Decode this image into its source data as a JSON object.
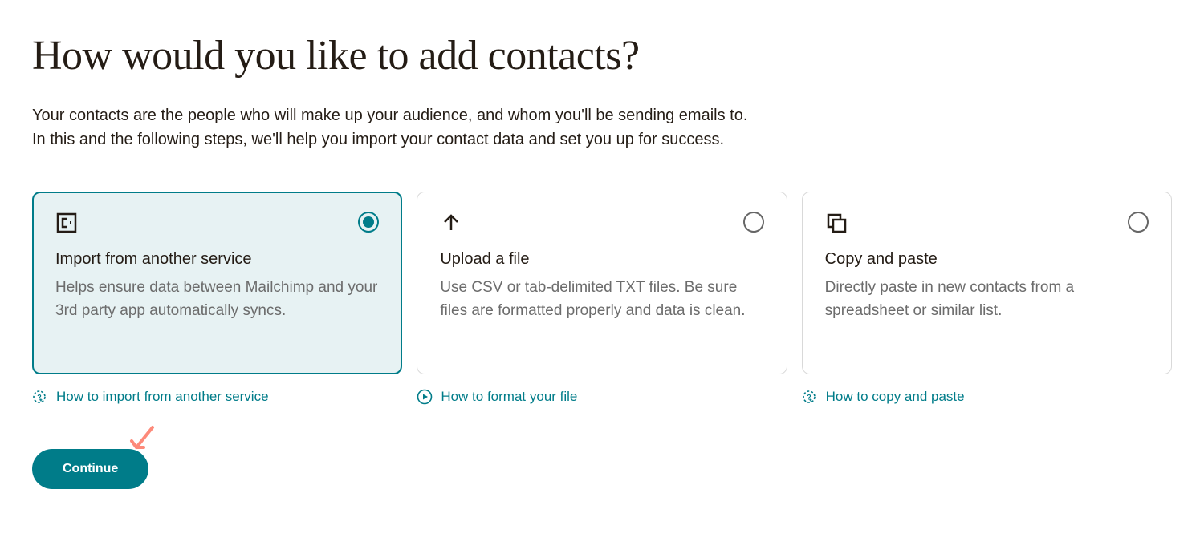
{
  "page": {
    "title": "How would you like to add contacts?",
    "description_line1": "Your contacts are the people who will make up your audience, and whom you'll be sending emails to.",
    "description_line2": "In this and the following steps, we'll help you import your contact data and set you up for success."
  },
  "options": [
    {
      "title": "Import from another service",
      "description": "Helps ensure data between Mailchimp and your 3rd party app automatically syncs.",
      "help_label": "How to import from another service",
      "selected": true
    },
    {
      "title": "Upload a file",
      "description": "Use CSV or tab-delimited TXT files. Be sure files are formatted properly and data is clean.",
      "help_label": "How to format your file",
      "selected": false
    },
    {
      "title": "Copy and paste",
      "description": "Directly paste in new contacts from a spreadsheet or similar list.",
      "help_label": "How to copy and paste",
      "selected": false
    }
  ],
  "buttons": {
    "continue": "Continue"
  },
  "colors": {
    "accent": "#007c89",
    "text": "#241c15",
    "muted": "#6c6c6c",
    "annotation": "#ff7f7f"
  }
}
